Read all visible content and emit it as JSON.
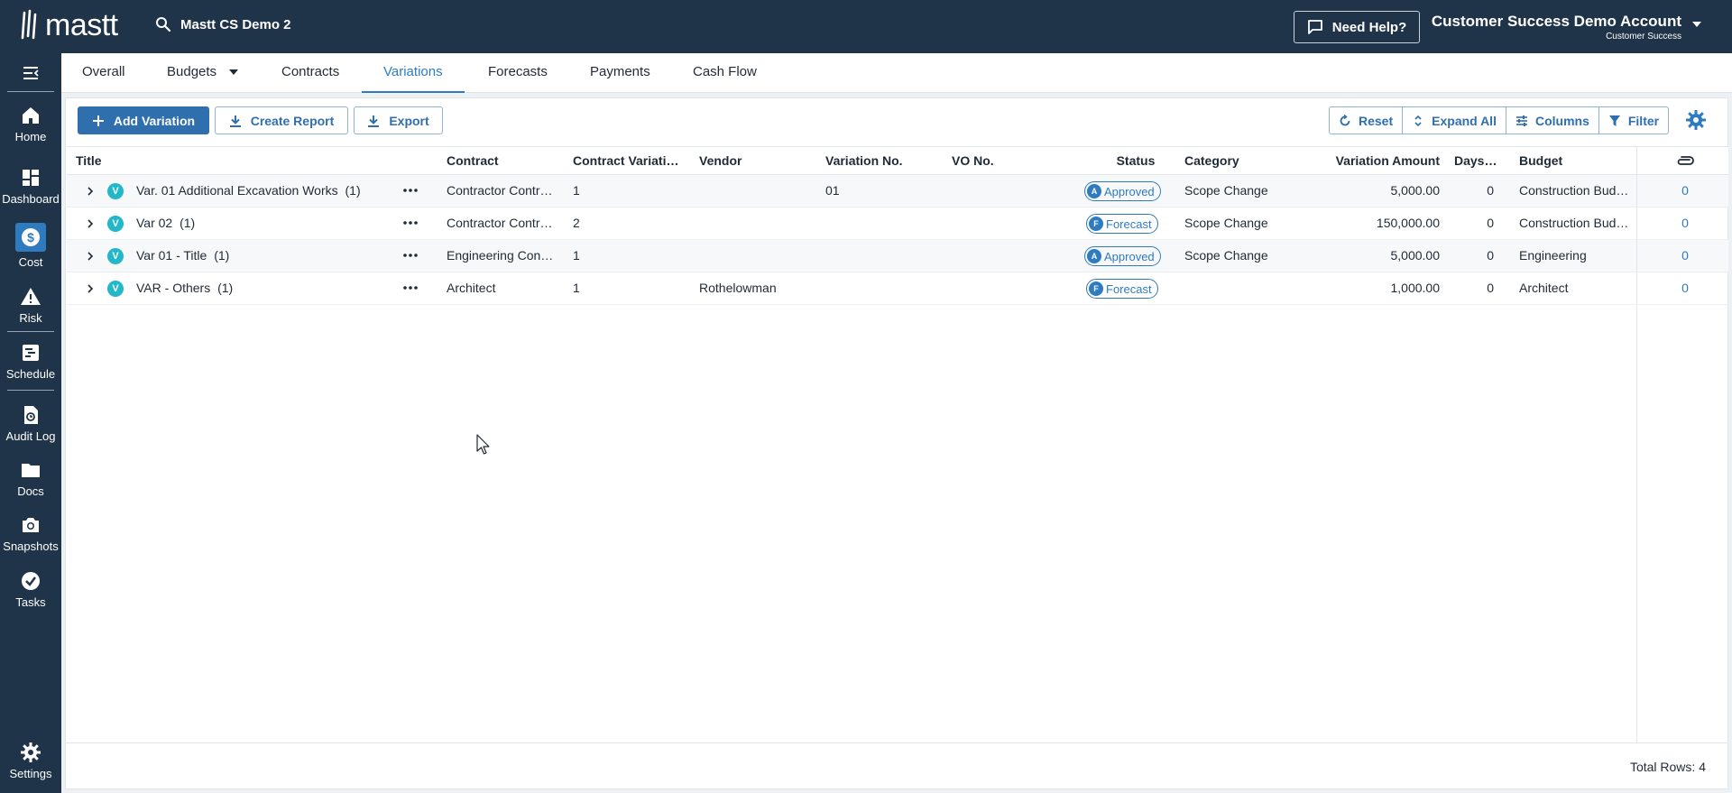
{
  "topbar": {
    "logo_text": "mastt",
    "project": "Mastt CS Demo 2",
    "help_label": "Need Help?",
    "account_name": "Customer Success Demo Account",
    "account_role": "Customer Success"
  },
  "sidebar": {
    "items": [
      {
        "label": "Home",
        "icon": "home-icon"
      },
      {
        "label": "Dashboard",
        "icon": "dashboard-icon"
      },
      {
        "label": "Cost",
        "icon": "dollar-icon",
        "active": true
      },
      {
        "label": "Risk",
        "icon": "warning-icon"
      },
      {
        "label": "Schedule",
        "icon": "schedule-icon"
      },
      {
        "label": "Audit Log",
        "icon": "audit-log-icon"
      },
      {
        "label": "Docs",
        "icon": "folder-icon"
      },
      {
        "label": "Snapshots",
        "icon": "camera-icon"
      },
      {
        "label": "Tasks",
        "icon": "check-circle-icon"
      },
      {
        "label": "Settings",
        "icon": "gear-icon"
      }
    ]
  },
  "tabs": [
    {
      "label": "Overall"
    },
    {
      "label": "Budgets"
    },
    {
      "label": "Contracts"
    },
    {
      "label": "Variations",
      "active": true
    },
    {
      "label": "Forecasts"
    },
    {
      "label": "Payments"
    },
    {
      "label": "Cash Flow"
    }
  ],
  "toolbar": {
    "add_label": "Add Variation",
    "report_label": "Create Report",
    "export_label": "Export",
    "reset_label": "Reset",
    "expand_label": "Expand All",
    "columns_label": "Columns",
    "filter_label": "Filter"
  },
  "table": {
    "columns": [
      "Title",
      "Contract",
      "Contract Variation No.",
      "Vendor",
      "Variation No.",
      "VO No.",
      "Status",
      "Category",
      "Variation Amount",
      "Days Extension",
      "Budget"
    ],
    "rows": [
      {
        "title": "Var. 01 Additional Excavation Works",
        "count": "(1)",
        "contract": "Contractor Contract",
        "contract_var_no": "1",
        "vendor": "",
        "variation_no": "01",
        "vo_no": "",
        "status_letter": "A",
        "status": "Approved",
        "category": "Scope Change",
        "amount": "5,000.00",
        "days": "0",
        "budget": "Construction Budget",
        "attachments": "0"
      },
      {
        "title": "Var 02",
        "count": "(1)",
        "contract": "Contractor Contract",
        "contract_var_no": "2",
        "vendor": "",
        "variation_no": "",
        "vo_no": "",
        "status_letter": "F",
        "status": "Forecast",
        "category": "Scope Change",
        "amount": "150,000.00",
        "days": "0",
        "budget": "Construction Budget",
        "attachments": "0"
      },
      {
        "title": "Var 01 - Title",
        "count": "(1)",
        "contract": "Engineering Contract",
        "contract_var_no": "1",
        "vendor": "",
        "variation_no": "",
        "vo_no": "",
        "status_letter": "A",
        "status": "Approved",
        "category": "Scope Change",
        "amount": "5,000.00",
        "days": "0",
        "budget": "Engineering",
        "attachments": "0"
      },
      {
        "title": "VAR - Others",
        "count": "(1)",
        "contract": "Architect",
        "contract_var_no": "1",
        "vendor": "Rothelowman",
        "variation_no": "",
        "vo_no": "",
        "status_letter": "F",
        "status": "Forecast",
        "category": "",
        "amount": "1,000.00",
        "days": "0",
        "budget": "Architect",
        "attachments": "0"
      }
    ]
  },
  "footer": {
    "total_rows": "Total Rows: 4"
  }
}
